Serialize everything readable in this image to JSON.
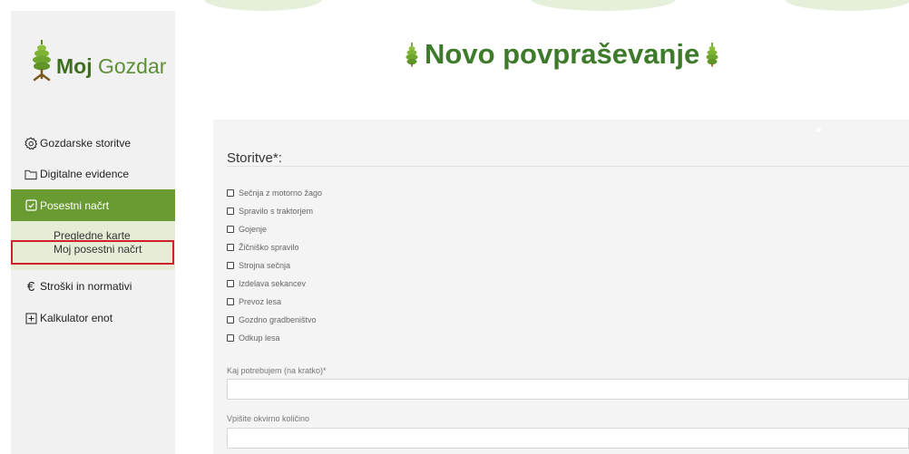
{
  "brand": {
    "name_bold": "Moj",
    "name_rest": " Gozdar",
    "accent_color": "#6a9a32",
    "logo_icon": "pine-cone-icon"
  },
  "sidebar": {
    "items": [
      {
        "label": "Gozdarske storitve",
        "icon": "gear-icon"
      },
      {
        "label": "Digitalne evidence",
        "icon": "folder-icon"
      },
      {
        "label": "Posestni načrt",
        "icon": "document-check-icon",
        "active": true
      },
      {
        "label": "Stroški in normativi",
        "icon": "euro-icon"
      },
      {
        "label": "Kalkulator enot",
        "icon": "plus-box-icon"
      }
    ],
    "sub_items": [
      {
        "label": "Pregledne karte"
      },
      {
        "label": "Moj posestni načrt",
        "highlighted": true
      }
    ]
  },
  "main": {
    "title": "Novo povpraševanje",
    "title_icon": "pine-cone-icon"
  },
  "form": {
    "section_title": "Storitve*:",
    "services": [
      {
        "label": "Sečnja z motorno žago",
        "checked": false
      },
      {
        "label": "Spravilo s traktorjem",
        "checked": false
      },
      {
        "label": "Gojenje",
        "checked": false
      },
      {
        "label": "Žičniško spravilo",
        "checked": false
      },
      {
        "label": "Strojna sečnja",
        "checked": false
      },
      {
        "label": "Izdelava sekancev",
        "checked": false
      },
      {
        "label": "Prevoz lesa",
        "checked": false
      },
      {
        "label": "Gozdno gradbeništvo",
        "checked": false
      },
      {
        "label": "Odkup lesa",
        "checked": false
      }
    ],
    "need_label": "Kaj potrebujem (na kratko)*",
    "need_value": "",
    "quantity_label": "Vpišite okvirno količino",
    "quantity_value": ""
  }
}
